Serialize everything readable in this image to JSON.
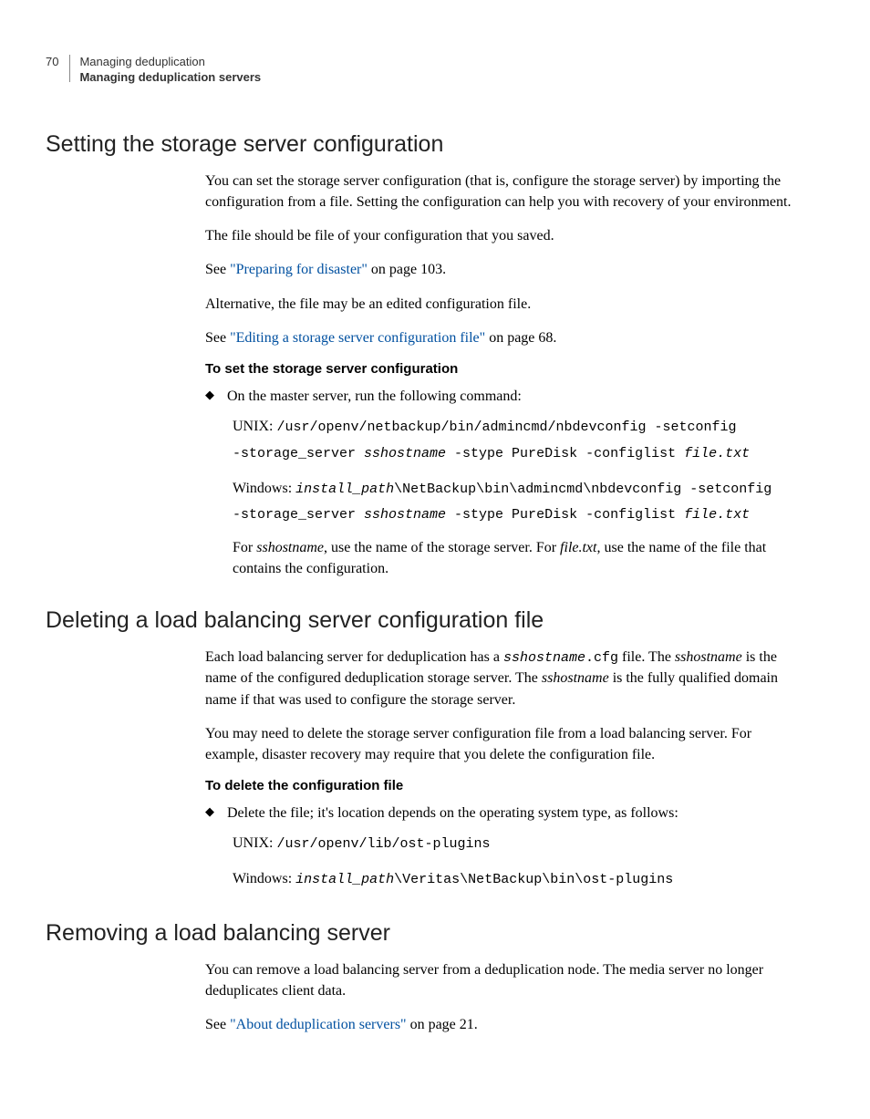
{
  "header": {
    "page_number": "70",
    "chapter": "Managing deduplication",
    "section": "Managing deduplication servers"
  },
  "section1": {
    "title": "Setting the storage server configuration",
    "p1": "You can set the storage server configuration (that is, configure the storage server) by importing the configuration from a file. Setting the configuration can help you with recovery of your environment.",
    "p2": "The file should be file of your configuration that you saved.",
    "p3_prefix": "See ",
    "p3_link": "\"Preparing for disaster\"",
    "p3_suffix": " on page 103.",
    "p4": "Alternative, the file may be an edited configuration file.",
    "p5_prefix": "See ",
    "p5_link": "\"Editing a storage server configuration file\"",
    "p5_suffix": " on page 68.",
    "procedure_title": "To set the storage server configuration",
    "bullet1": "On the master server, run the following command:",
    "unix_label": "UNIX: ",
    "unix_cmd_a": "/usr/openv/netbackup/bin/admincmd/nbdevconfig -setconfig",
    "unix_cmd_b1": "-storage_server ",
    "unix_cmd_b_italic1": "sshostname",
    "unix_cmd_b2": " -stype PureDisk -configlist ",
    "unix_cmd_b_italic2": "file.txt",
    "win_label": "Windows: ",
    "win_cmd_a_italic": "install_path",
    "win_cmd_a": "\\NetBackup\\bin\\admincmd\\nbdevconfig -setconfig",
    "win_cmd_b1": "-storage_server ",
    "win_cmd_b_italic1": "sshostname",
    "win_cmd_b2": " -stype PureDisk -configlist ",
    "win_cmd_b_italic2": "file.txt",
    "note1_a": "For ",
    "note1_i1": "sshostname",
    "note1_b": ", use the name of the storage server. For ",
    "note1_i2": "file.txt",
    "note1_c": ", use the name of the file that contains the configuration."
  },
  "section2": {
    "title": "Deleting a load balancing server configuration file",
    "p1_a": "Each load balancing server for deduplication has a ",
    "p1_code": "sshostname",
    "p1_code2": ".cfg",
    "p1_b": " file. The ",
    "p1_i1": "sshostname",
    "p1_c": " is the name of the configured deduplication storage server. The ",
    "p1_i2": "sshostname",
    "p1_d": " is the fully qualified domain name if that was used to configure the storage server.",
    "p2": "You may need to delete the storage server configuration file from a load balancing server. For example, disaster recovery may require that you delete the configuration file.",
    "procedure_title": "To delete the configuration file",
    "bullet1": "Delete the file; it's location depends on the operating system type, as follows:",
    "unix_label": "UNIX: ",
    "unix_cmd": "/usr/openv/lib/ost-plugins",
    "win_label": "Windows: ",
    "win_cmd_italic": "install_path",
    "win_cmd": "\\Veritas\\NetBackup\\bin\\ost-plugins"
  },
  "section3": {
    "title": "Removing a load balancing server",
    "p1": "You can remove a load balancing server from a deduplication node. The media server no longer deduplicates client data.",
    "p2_prefix": "See ",
    "p2_link": "\"About deduplication servers\"",
    "p2_suffix": " on page 21."
  }
}
